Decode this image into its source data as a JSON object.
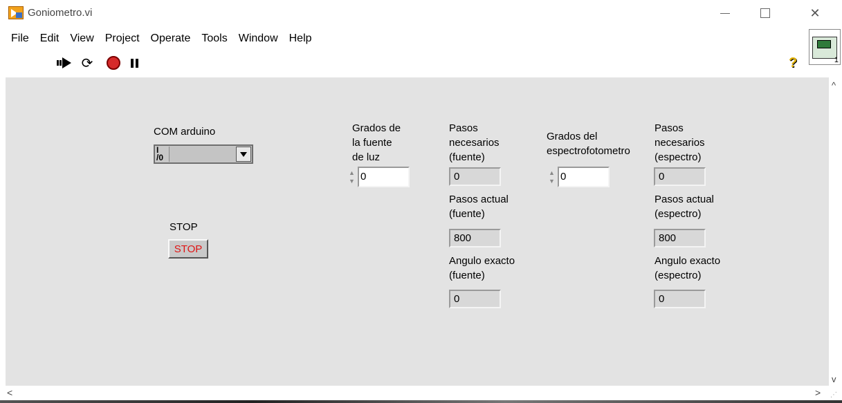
{
  "window": {
    "title": "Goniometro.vi",
    "colors": {
      "panel_bg": "#e3e3e3",
      "stop_text": "#e01414",
      "abort": "#d62a2a"
    }
  },
  "menu": [
    "File",
    "Edit",
    "View",
    "Project",
    "Operate",
    "Tools",
    "Window",
    "Help"
  ],
  "toolbar": {
    "icons": [
      "run-arrow-icon",
      "run-continuously-icon",
      "abort-execution-icon",
      "pause-icon"
    ],
    "run_continuously_glyph": "⟳",
    "help_glyph": "?",
    "vi_icon_number": "1"
  },
  "panel": {
    "com": {
      "label": "COM arduino",
      "io_glyph": "I/O"
    },
    "stop": {
      "label": "STOP",
      "button_text": "STOP"
    },
    "fuente": {
      "grados_label": "Grados de\nla fuente\nde luz",
      "grados_value": "0",
      "pasos_necesarios_label": "Pasos\nnecesarios\n(fuente)",
      "pasos_necesarios_value": "0",
      "pasos_actual_label": "Pasos actual\n(fuente)",
      "pasos_actual_value": "800",
      "angulo_label": "Angulo exacto\n(fuente)",
      "angulo_value": "0"
    },
    "espectro": {
      "grados_label": "Grados del\nespectrofotometro",
      "grados_value": "0",
      "pasos_necesarios_label": "Pasos\nnecesarios\n(espectro)",
      "pasos_necesarios_value": "0",
      "pasos_actual_label": "Pasos actual\n(espectro)",
      "pasos_actual_value": "800",
      "angulo_label": "Angulo exacto\n(espectro)",
      "angulo_value": "0"
    }
  }
}
